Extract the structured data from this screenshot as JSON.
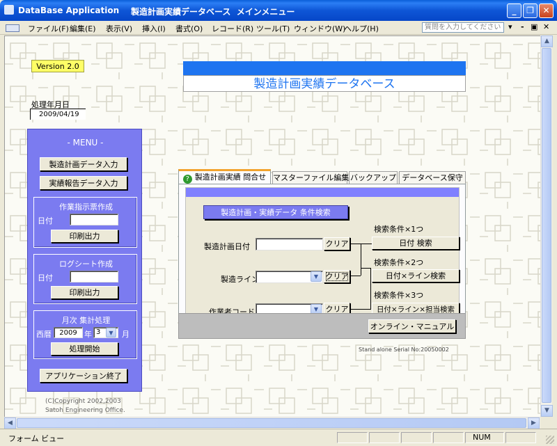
{
  "window": {
    "app_name": "DataBase Application",
    "title": "製造計画実績データベース  メインメニュー"
  },
  "menu": {
    "items": [
      "ファイル(F)",
      "編集(E)",
      "表示(V)",
      "挿入(I)",
      "書式(O)",
      "レコード(R)",
      "ツール(T)",
      "ウィンドウ(W)",
      "ヘルプ(H)"
    ],
    "search_placeholder": "質問を入力してください"
  },
  "form": {
    "version": "Version 2.0",
    "banner_title": "製造計画実績データベース",
    "date_label": "処理年月日",
    "date_value": "2009/04/19",
    "copyright_line1": "(C)Copyright 2002,2003",
    "copyright_line2": "Satoh Engineering Office."
  },
  "left_menu": {
    "title": "- MENU -",
    "plan_entry": "製造計画データ入力",
    "report_entry": "実績報告データ入力",
    "work_order": {
      "title": "作業指示票作成",
      "date_label": "日付",
      "print": "印刷出力"
    },
    "log_sheet": {
      "title": "ログシート作成",
      "date_label": "日付",
      "print": "印刷出力"
    },
    "monthly": {
      "title": "月次 集計処理",
      "era_label": "西暦",
      "year": "2009",
      "year_unit": "年",
      "month": "3",
      "month_unit": "月",
      "start": "処理開始"
    },
    "exit": "アプリケーション終了"
  },
  "tabs": {
    "items": [
      "製造計画実績 問合せ",
      "マスターファイル編集",
      "バックアップ",
      "データベース保守"
    ],
    "active_index": 0
  },
  "query": {
    "header": "製造計画・実績データ  条件検索",
    "plan_date_label": "製造計画日付",
    "line_label": "製造ライン",
    "worker_label": "作業者コード",
    "clear_label": "クリア",
    "cond1_label": "検索条件×1つ",
    "cond1_button": "日付 検索",
    "cond2_label": "検索条件×2つ",
    "cond2_button": "日付×ライン検索",
    "cond3_label": "検索条件×3つ",
    "cond3_button": "日付×ライン×担当検索",
    "manual_button": "オンライン・マニュアル",
    "serial": "Stand alone Serial No:20050002"
  },
  "status": {
    "left": "フォーム ビュー",
    "num": "NUM"
  }
}
